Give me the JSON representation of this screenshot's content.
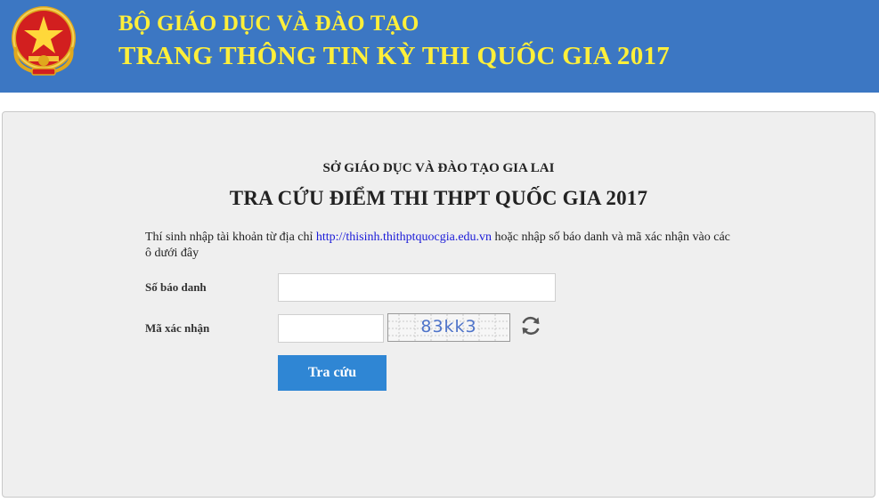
{
  "header": {
    "line1": "BỘ GIÁO DỤC VÀ ĐÀO TẠO",
    "line2": "TRANG THÔNG TIN KỲ THI QUỐC GIA 2017",
    "background_color": "#3c77c3",
    "text_color": "#ffef3a",
    "emblem_icon": "national-emblem-icon"
  },
  "form": {
    "department": "SỞ GIÁO DỤC VÀ ĐÀO TẠO GIA LAI",
    "title": "TRA CỨU ĐIỂM THI THPT QUỐC GIA 2017",
    "instruction_prefix": "Thí sinh nhập tài khoản từ địa chỉ",
    "instruction_link": "http://thisinh.thithptquocgia.edu.vn",
    "instruction_suffix": "hoặc nhập số báo danh và mã xác nhận vào các ô dưới đây",
    "candidate_number_label": "Số báo danh",
    "candidate_number_value": "",
    "captcha_label": "Mã xác nhận",
    "captcha_value": "",
    "captcha_image_text": "83kk3",
    "refresh_icon": "refresh-icon",
    "submit_label": "Tra cứu",
    "button_color": "#2f86d4"
  }
}
